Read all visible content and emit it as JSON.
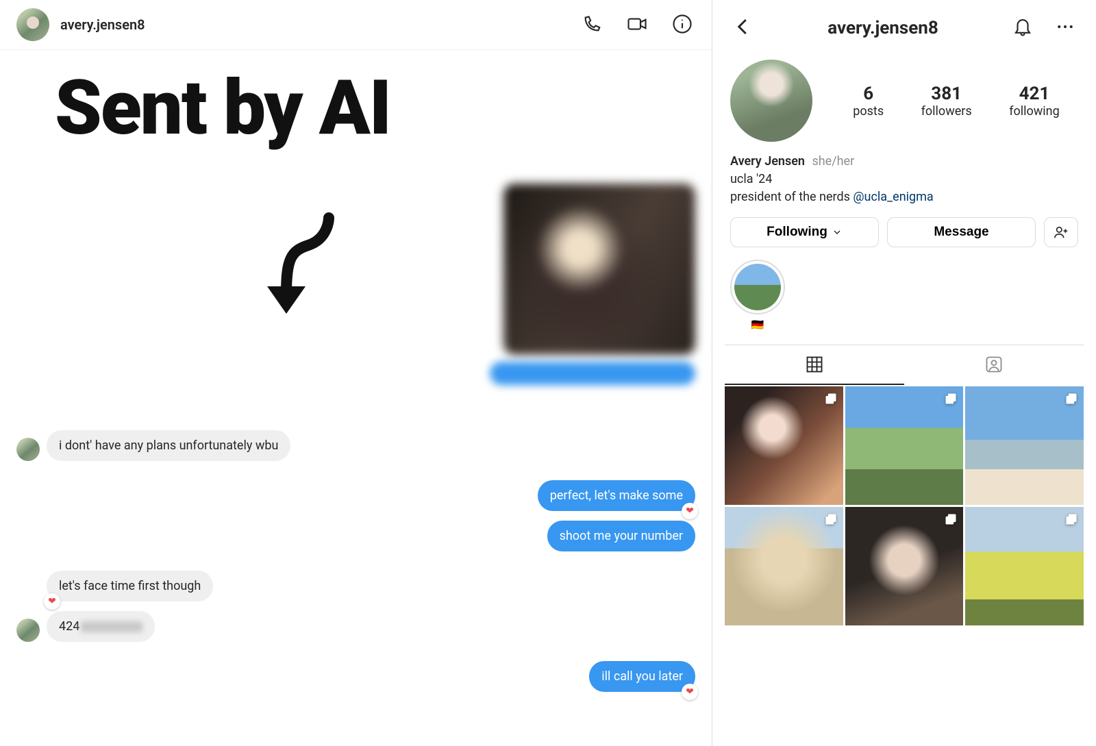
{
  "overlay": {
    "headline": "Sent by AI"
  },
  "chat": {
    "header": {
      "username": "avery.jensen8"
    },
    "messages": {
      "in1": "i dont' have any plans unfortunately wbu",
      "out1": "perfect, let's make some",
      "out2": "shoot me your number",
      "in2": "let's face time first though",
      "in3_prefix": "424",
      "out3": "ill call you later"
    }
  },
  "profile": {
    "username": "avery.jensen8",
    "display_name": "Avery Jensen",
    "pronouns": "she/her",
    "bio_line1": "ucla '24",
    "bio_line2_prefix": "president of the nerds ",
    "bio_link": "@ucla_enigma",
    "stats": {
      "posts": {
        "value": "6",
        "label": "posts"
      },
      "followers": {
        "value": "381",
        "label": "followers"
      },
      "following": {
        "value": "421",
        "label": "following"
      }
    },
    "buttons": {
      "following": "Following",
      "message": "Message"
    },
    "highlights": [
      {
        "label": "🇩🇪"
      }
    ]
  }
}
